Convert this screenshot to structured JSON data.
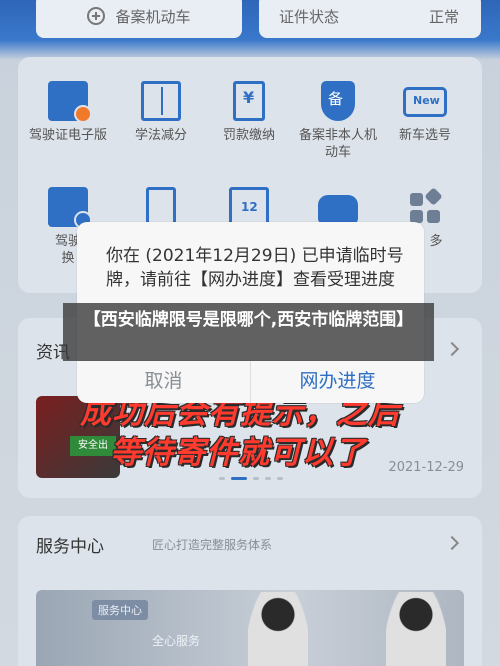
{
  "top": {
    "register_label": "备案机动车",
    "status_label": "证件状态",
    "status_value": "正常"
  },
  "functions": [
    {
      "label": "驾驶证电子版",
      "icon": "license-icon"
    },
    {
      "label": "学法减分",
      "icon": "book-icon"
    },
    {
      "label": "罚款缴纳",
      "icon": "fine-icon"
    },
    {
      "label": "备案非本人机动车",
      "icon": "shield-icon"
    },
    {
      "label": "新车选号",
      "icon": "new-icon"
    },
    {
      "label": "驾驶",
      "icon": "id-card-icon"
    },
    {
      "label": "",
      "icon": "document-icon"
    },
    {
      "label": "",
      "icon": "calendar-icon"
    },
    {
      "label": "",
      "icon": "car-icon"
    },
    {
      "label": "多",
      "icon": "more-icon"
    }
  ],
  "function_row2_label_b": "换",
  "news": {
    "title": "资讯",
    "image_badge": "安全出",
    "date": "2021-12-29"
  },
  "overlay": {
    "line1": "成功后会有提示，之后",
    "line2": "等待寄件就可以了"
  },
  "service": {
    "title": "服务中心",
    "subtitle": "匠心打造完整服务体系",
    "banner_pill": "服务中心",
    "banner_text": "全心服务"
  },
  "modal": {
    "message": "你在 (2021年12月29日) 已申请临时号牌，请前往【网办进度】查看受理进度",
    "cancel_label": "取消",
    "progress_label": "网办进度"
  },
  "caption": {
    "text": "【西安临牌限号是限哪个,西安市临牌范围】"
  }
}
